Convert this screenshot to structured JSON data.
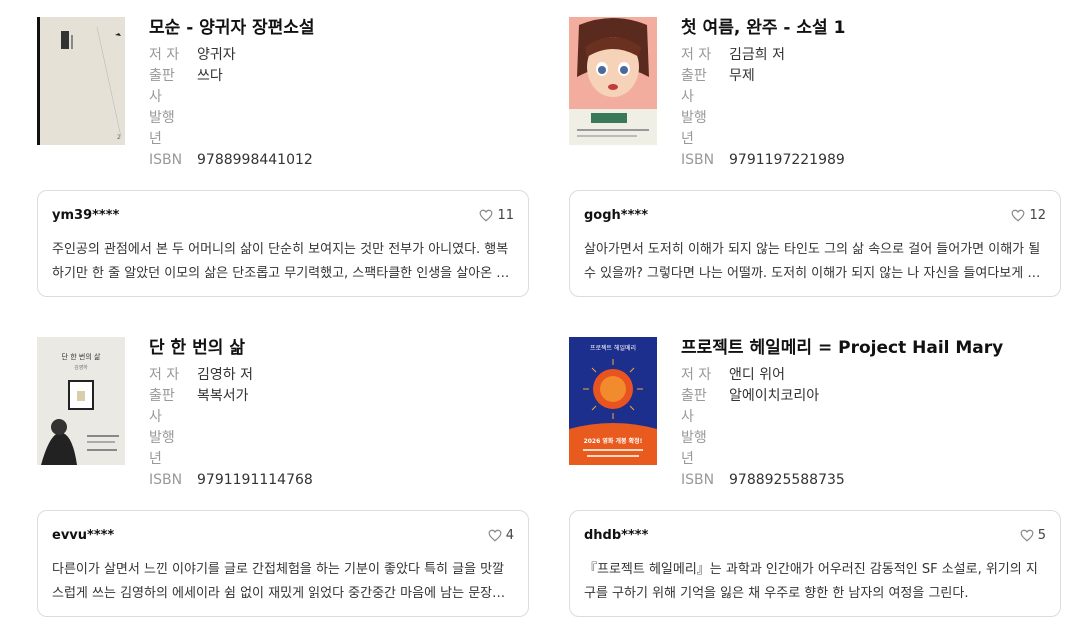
{
  "labels": {
    "author": "저 자",
    "publisher_line1": "출판",
    "publisher_line2": "사",
    "year_line1": "발행",
    "year_line2": "년",
    "isbn": "ISBN"
  },
  "books": [
    {
      "title": "모순 - 양귀자 장편소설",
      "author": "양귀자",
      "publisher": "쓰다",
      "isbn": "9788998441012",
      "review": {
        "user": "ym39****",
        "likes": "11",
        "text": "주인공의 관점에서 본 두 어머니의 삶이 단순히 보여지는 것만 전부가 아니였다. 행복하기만 한 줄 알았던 이모의 삶은 단조롭고 무기력했고, 스팩타클한 인생을 살아온 어머니의 삶은 오히려 생기가 넘쳤다."
      }
    },
    {
      "title": "첫 여름, 완주 - 소설 1",
      "author": "김금희 저",
      "publisher": "무제",
      "isbn": "9791197221989",
      "review": {
        "user": "gogh****",
        "likes": "12",
        "text": "살아가면서 도저히 이해가 되지 않는 타인도 그의 삶 속으로 걸어 들어가면 이해가 될 수 있을까? 그렇다면 나는 어떨까. 도저히 이해가 되지 않는 나 자신을 들여다보게 되는 이야기."
      }
    },
    {
      "title": "단 한 번의 삶",
      "author": "김영하 저",
      "publisher": "복복서가",
      "isbn": "9791191114768",
      "review": {
        "user": "evvu****",
        "likes": "4",
        "text": "다른이가 살면서 느낀 이야기를 글로 간접체험을 하는 기분이 좋았다 특히 글을 맛깔스럽게 쓰는 김영하의 에세이라 쉼 없이 재밌게 읽었다 중간중간 마음에 남는 문장들이 많았다."
      }
    },
    {
      "title": "프로젝트 헤일메리 = Project Hail Mary",
      "author": "앤디 위어",
      "publisher": "알에이치코리아",
      "isbn": "9788925588735",
      "review": {
        "user": "dhdb****",
        "likes": "5",
        "text": "『프로젝트 헤일메리』는 과학과 인간애가 어우러진 감동적인 SF 소설로, 위기의 지구를 구하기 위해 기억을 잃은 채 우주로 향한 한 남자의 여정을 그린다."
      }
    }
  ],
  "cover_texts": {
    "book3_cover_title": "단 한 번의 삶",
    "book3_cover_author": "김영하",
    "book4_cover_title": "프로젝트 헤일메리",
    "book4_cover_banner": "2026 영화 개봉 확정!"
  },
  "colors": {
    "heart": "#888888",
    "card_border": "#dcdcdc",
    "label": "#999999"
  }
}
